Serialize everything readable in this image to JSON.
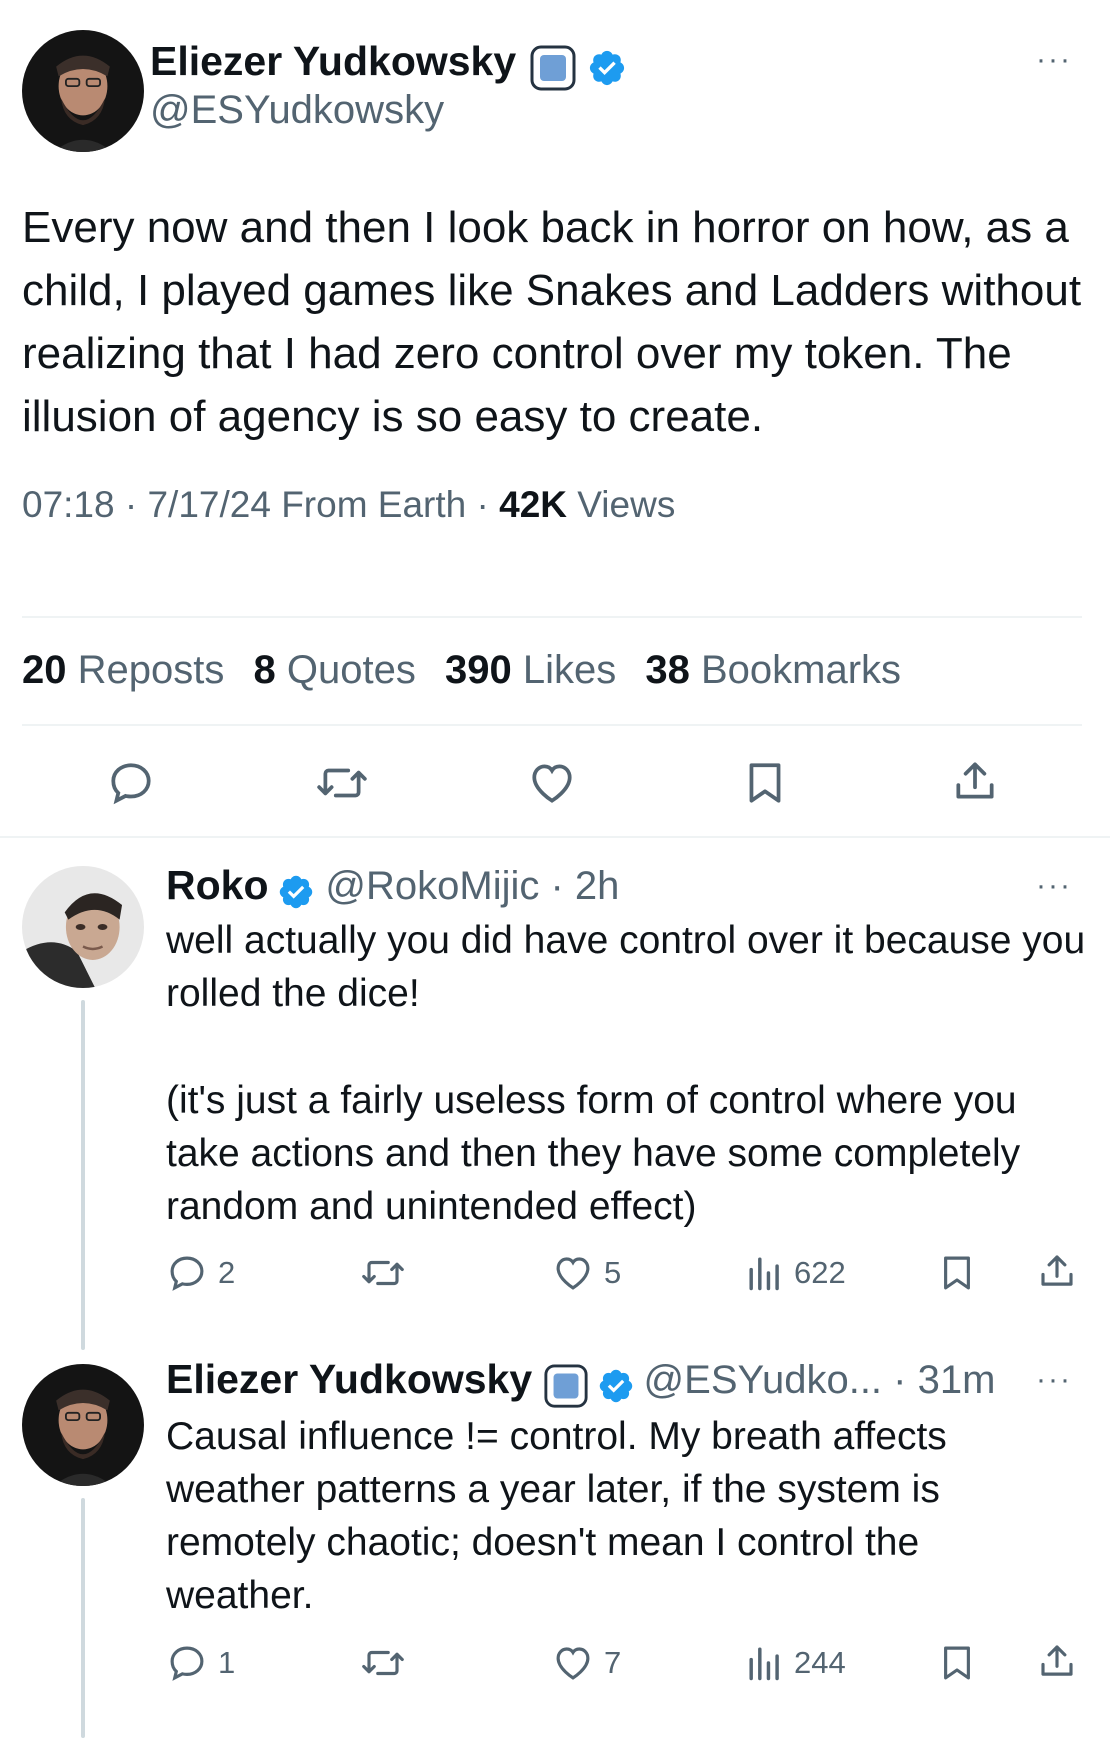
{
  "main_tweet": {
    "author_name": "Eliezer Yudkowsky",
    "handle": "@ESYudkowsky",
    "text": "Every now and then I look back in horror on how, as a child, I played games like Snakes and Ladders without realizing that I had zero control over my token.  The illusion of agency is so easy to create.",
    "meta_time": "07:18 · 7/17/24 From Earth · ",
    "views_count": "42K",
    "views_label": " Views",
    "stats": {
      "reposts_count": "20",
      "reposts_label": "Reposts",
      "quotes_count": "8",
      "quotes_label": "Quotes",
      "likes_count": "390",
      "likes_label": "Likes",
      "bookmarks_count": "38",
      "bookmarks_label": "Bookmarks"
    },
    "more": "···"
  },
  "reply_1": {
    "author_name": "Roko",
    "handle_time": "@RokoMijic · 2h",
    "text_p1": "well actually you did have control over it because you rolled the dice!",
    "text_p2": "(it's just a fairly useless form of control where you take actions and then they have some completely random and unintended effect)",
    "replies": "2",
    "likes": "5",
    "views": "622",
    "more": "···"
  },
  "reply_2": {
    "author_name": "Eliezer Yudkowsky",
    "handle_time": "@ESYudko... · 31m",
    "text": "Causal influence != control.  My breath affects weather patterns a year later, if the system is remotely chaotic; doesn't mean I control the weather.",
    "replies": "1",
    "likes": "7",
    "views": "244",
    "more": "···"
  },
  "colors": {
    "verified": "#1d9bf0",
    "muted": "#536471",
    "divider": "#eff3f4",
    "thread_line": "#cfd9de"
  },
  "icons": [
    "more-icon",
    "verified-badge-icon",
    "affiliate-badge-icon",
    "reply-icon",
    "repost-icon",
    "like-icon",
    "bookmark-icon",
    "share-icon",
    "views-icon"
  ]
}
